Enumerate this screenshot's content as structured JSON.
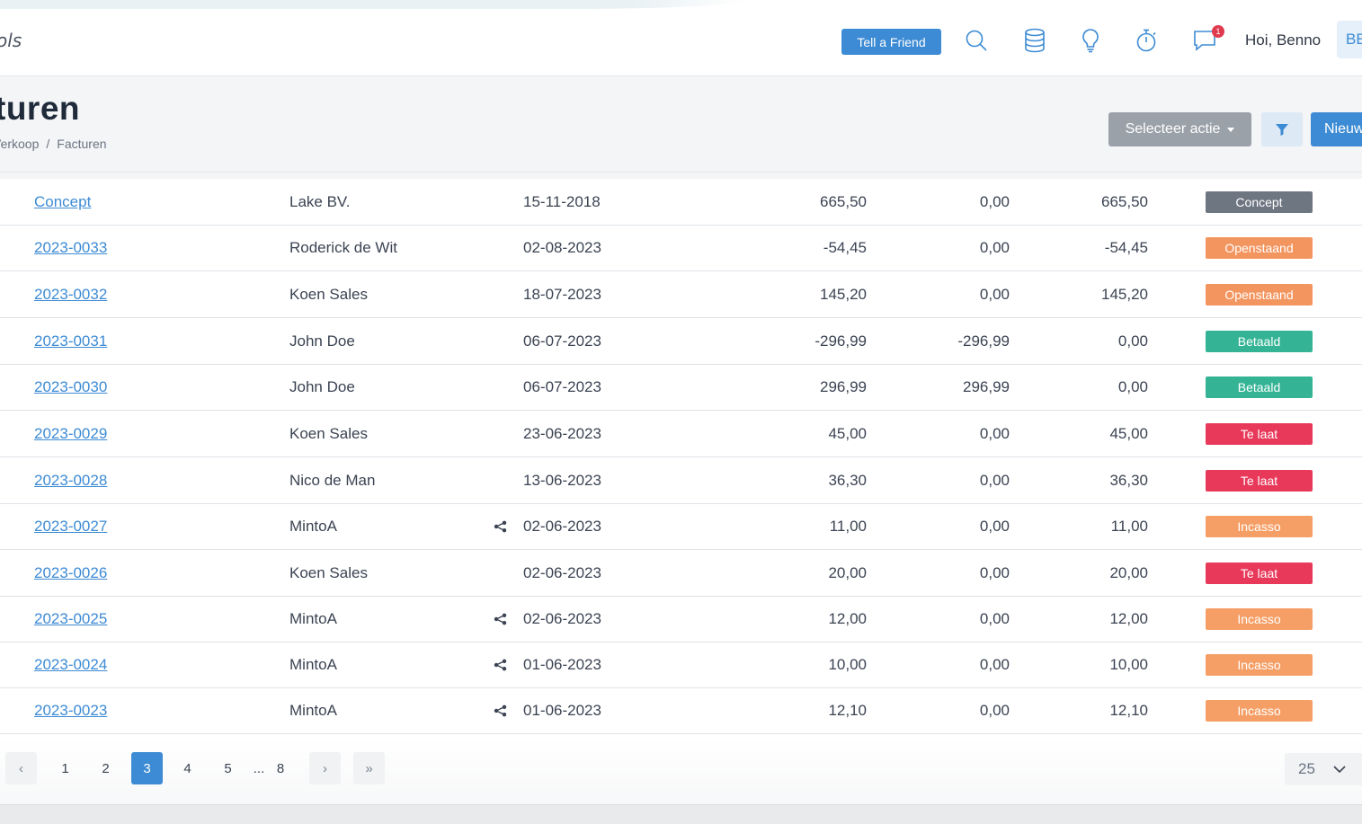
{
  "header": {
    "app_name": "ols",
    "tell_friend": "Tell a Friend",
    "notification_count": "1",
    "greeting": "Hoi, Benno",
    "avatar_initials": "BE"
  },
  "page": {
    "title": "turen",
    "breadcrumb": [
      "Verkoop",
      "/",
      "Facturen"
    ],
    "select_action": "Selecteer actie",
    "new_label": "Nieuw"
  },
  "colors": {
    "Concept": "#6e7681",
    "Openstaand": "#f3955f",
    "Betaald": "#35b495",
    "Te laat": "#e8395a",
    "Incasso": "#f59f66"
  },
  "rows": [
    {
      "number": "Concept",
      "client": "Lake BV.",
      "shared": false,
      "date": "15-11-2018",
      "amount": "665,50",
      "paid": "0,00",
      "open": "665,50",
      "status": "Concept"
    },
    {
      "number": "2023-0033",
      "client": "Roderick de Wit",
      "shared": false,
      "date": "02-08-2023",
      "amount": "-54,45",
      "paid": "0,00",
      "open": "-54,45",
      "status": "Openstaand"
    },
    {
      "number": "2023-0032",
      "client": "Koen Sales",
      "shared": false,
      "date": "18-07-2023",
      "amount": "145,20",
      "paid": "0,00",
      "open": "145,20",
      "status": "Openstaand"
    },
    {
      "number": "2023-0031",
      "client": "John Doe",
      "shared": false,
      "date": "06-07-2023",
      "amount": "-296,99",
      "paid": "-296,99",
      "open": "0,00",
      "status": "Betaald"
    },
    {
      "number": "2023-0030",
      "client": "John Doe",
      "shared": false,
      "date": "06-07-2023",
      "amount": "296,99",
      "paid": "296,99",
      "open": "0,00",
      "status": "Betaald"
    },
    {
      "number": "2023-0029",
      "client": "Koen Sales",
      "shared": false,
      "date": "23-06-2023",
      "amount": "45,00",
      "paid": "0,00",
      "open": "45,00",
      "status": "Te laat"
    },
    {
      "number": "2023-0028",
      "client": "Nico de Man",
      "shared": false,
      "date": "13-06-2023",
      "amount": "36,30",
      "paid": "0,00",
      "open": "36,30",
      "status": "Te laat"
    },
    {
      "number": "2023-0027",
      "client": "MintoA",
      "shared": true,
      "date": "02-06-2023",
      "amount": "11,00",
      "paid": "0,00",
      "open": "11,00",
      "status": "Incasso"
    },
    {
      "number": "2023-0026",
      "client": "Koen Sales",
      "shared": false,
      "date": "02-06-2023",
      "amount": "20,00",
      "paid": "0,00",
      "open": "20,00",
      "status": "Te laat"
    },
    {
      "number": "2023-0025",
      "client": "MintoA",
      "shared": true,
      "date": "02-06-2023",
      "amount": "12,00",
      "paid": "0,00",
      "open": "12,00",
      "status": "Incasso"
    },
    {
      "number": "2023-0024",
      "client": "MintoA",
      "shared": true,
      "date": "01-06-2023",
      "amount": "10,00",
      "paid": "0,00",
      "open": "10,00",
      "status": "Incasso"
    },
    {
      "number": "2023-0023",
      "client": "MintoA",
      "shared": true,
      "date": "01-06-2023",
      "amount": "12,10",
      "paid": "0,00",
      "open": "12,10",
      "status": "Incasso"
    }
  ],
  "pagination": {
    "prev": "‹",
    "pages": [
      "1",
      "2",
      "3",
      "4",
      "5"
    ],
    "ellipsis": "...",
    "last_page": "8",
    "active": "3",
    "next": "›",
    "last": "»",
    "per_page": "25"
  }
}
